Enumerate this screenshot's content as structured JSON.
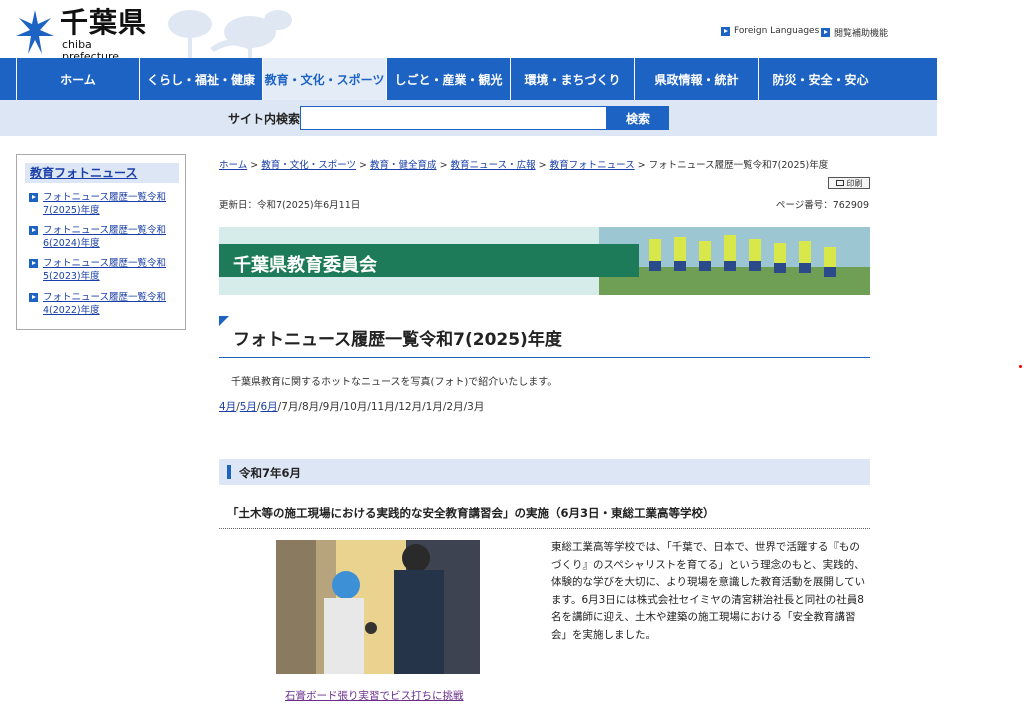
{
  "header": {
    "logo_jp": "千葉県",
    "logo_en": "chiba prefecture",
    "util_links": [
      {
        "label": "Foreign Languages"
      },
      {
        "label": "閲覧補助機能"
      }
    ]
  },
  "nav": {
    "items": [
      {
        "label": "ホーム"
      },
      {
        "label": "くらし・福祉・健康"
      },
      {
        "label": "教育・文化・スポーツ"
      },
      {
        "label": "しごと・産業・観光"
      },
      {
        "label": "環境・まちづくり"
      },
      {
        "label": "県政情報・統計"
      },
      {
        "label": "防災・安全・安心"
      }
    ],
    "active_index": 2
  },
  "search": {
    "label": "サイト内検索",
    "value": "",
    "button_label": "検索"
  },
  "sidebar": {
    "title": "教育フォトニュース",
    "items": [
      {
        "label": "フォトニュース履歴一覧令和7(2025)年度"
      },
      {
        "label": "フォトニュース履歴一覧令和6(2024)年度"
      },
      {
        "label": "フォトニュース履歴一覧令和5(2023)年度"
      },
      {
        "label": "フォトニュース履歴一覧令和4(2022)年度"
      }
    ]
  },
  "breadcrumb": {
    "links": [
      "ホーム",
      "教育・文化・スポーツ",
      "教育・健全育成",
      "教育ニュース・広報",
      "教育フォトニュース"
    ],
    "separator": " > ",
    "current": "フォトニュース履歴一覧令和7(2025)年度"
  },
  "print_label": "印刷",
  "updated": "更新日：令和7(2025)年6月11日",
  "page_number": "ページ番号：762909",
  "banner_title": "千葉県教育委員会",
  "page_title": "フォトニュース履歴一覧令和7(2025)年度",
  "intro": "千葉県教育に関するホットなニュースを写真(フォト)で紹介いたします。",
  "months": {
    "linked": [
      "4月",
      "5月",
      "6月"
    ],
    "plain": [
      "7月",
      "8月",
      "9月",
      "10月",
      "11月",
      "12月",
      "1月",
      "2月",
      "3月"
    ],
    "separator": "/"
  },
  "section": {
    "heading": "令和7年6月",
    "article_title": "「土木等の施工現場における実践的な安全教育講習会」の実施（6月3日・東総工業高等学校）",
    "photo_caption": "石膏ボード張り実習でビス打ちに挑戦",
    "body": "東総工業高等学校では、「千葉で、日本で、世界で活躍する『ものづくり』のスペシャリストを育てる」という理念のもと、実践的、体験的な学びを大切に、より現場を意識した教育活動を展開しています。6月3日には株式会社セイミヤの清宮耕治社長と同社の社員8名を講師に迎え、土木や建築の施工現場における「安全教育講習会」を実施しました。"
  },
  "colors": {
    "nav_blue": "#1c63c4",
    "light_blue": "#dde6f5",
    "banner_green": "#1e7b59",
    "link": "#1a3fa8"
  }
}
